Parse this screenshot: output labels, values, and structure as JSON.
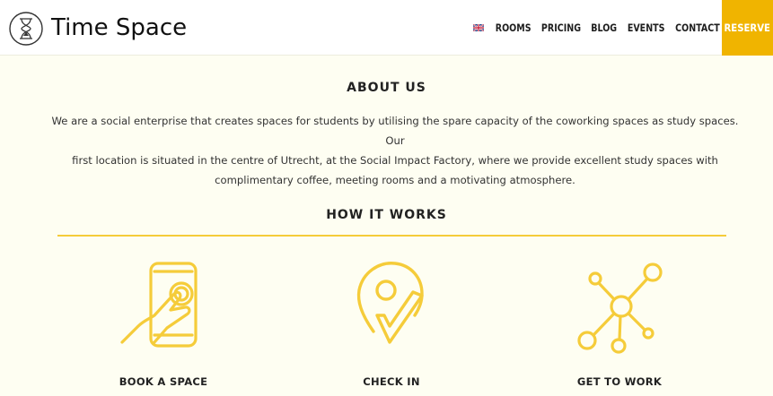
{
  "header": {
    "brand": "Time Space",
    "nav": [
      "ROOMS",
      "PRICING",
      "BLOG",
      "EVENTS",
      "CONTACT"
    ],
    "reserve": "RESERVE"
  },
  "about": {
    "title": "ABOUT US",
    "lines": [
      "We are a social enterprise that creates spaces for students by utilising the spare capacity of the coworking spaces as study spaces. Our",
      "first location is situated in the centre of Utrecht, at the Social Impact Factory, where we provide excellent study spaces with",
      "complimentary coffee, meeting rooms and a motivating atmosphere."
    ]
  },
  "how": {
    "title": "HOW IT WORKS",
    "steps": [
      {
        "label": "BOOK A SPACE",
        "icon": "tablet-touch-icon"
      },
      {
        "label": "CHECK IN",
        "icon": "location-check-icon"
      },
      {
        "label": "GET TO WORK",
        "icon": "network-icon"
      }
    ]
  },
  "colors": {
    "accent": "#f0b400",
    "icon": "#f5cc3a",
    "background": "#fefef2"
  }
}
